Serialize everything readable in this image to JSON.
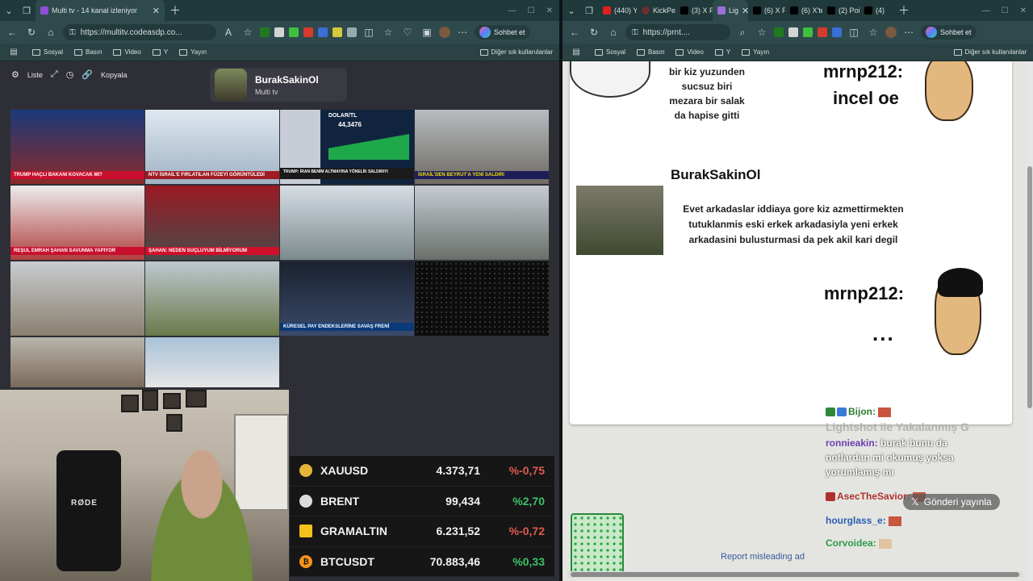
{
  "left_browser": {
    "tabs": [
      {
        "title": "Multi tv - 14 kanal izleniyor",
        "active": true
      }
    ],
    "url": "https://multitv.codeasdp.co...",
    "sohbet_label": "Sohbet et",
    "bookmarks": [
      "Sosyal",
      "Basın",
      "Video",
      "Y",
      "Yayın"
    ],
    "other_bookmarks": "Diğer sık kullanılanlar"
  },
  "multitv": {
    "toolbar": {
      "list_label": "Liste",
      "copy_label": "Kopyala"
    },
    "channel": {
      "name": "BurakSakinOl",
      "subtitle": "Multi tv"
    },
    "captions": [
      "TRUMP HAÇLI BAKANI KOVACAK MI?",
      "NTV İSRAİL'E FIRLATILAN FÜZEYİ GÖRÜNTÜLEDİ",
      "TRUMP: İRAN BENİM ALTMAYINA YÖNELİK SALDIRIYI",
      "İSRAİL'DEN BEYRUT'A YENİ SALDIRI",
      "REŞUL EMRAH ŞAHAN SAVUNMA YAPIYOR",
      "ŞAHAN: NEDEN SUÇLUYUM BİLMİYORUM",
      "KÜRESEL PAY ENDEKSLERİNE SAVAŞ FRENİ"
    ],
    "dolar_label": "DOLAR/TL",
    "dolar_value": "44,3476"
  },
  "webcam": {
    "mic_brand": "RØDE"
  },
  "ticker": [
    {
      "symbol": "XAUUSD",
      "value": "4.373,71",
      "change": "%-0,75",
      "color": "#e05a4f",
      "icon_color": "#e5b53a"
    },
    {
      "symbol": "BRENT",
      "value": "99,434",
      "change": "%2,70",
      "color": "#3cc26a",
      "icon_color": "#dcdcdc"
    },
    {
      "symbol": "GRAMALTIN",
      "value": "6.231,52",
      "change": "%-0,72",
      "color": "#e05a4f",
      "icon_color": "#f2c21b"
    },
    {
      "symbol": "BTCUSDT",
      "value": "70.883,46",
      "change": "%0,33",
      "color": "#3cc26a",
      "icon_color": "#f7931a"
    }
  ],
  "right_browser": {
    "tabs": [
      {
        "title": "(440) Y"
      },
      {
        "title": "KickPe"
      },
      {
        "title": "(3) X P"
      },
      {
        "title": "Lig",
        "active": true
      },
      {
        "title": "(6) X P"
      },
      {
        "title": "(6) X'te"
      },
      {
        "title": "(2) Poi"
      },
      {
        "title": "(4)"
      }
    ],
    "url": "https://prnt....",
    "sohbet_label": "Sohbet et",
    "bookmarks": [
      "Sosyal",
      "Basın",
      "Video",
      "Y",
      "Yayın"
    ],
    "other_bookmarks": "Diğer sık kullanılanlar"
  },
  "meme": {
    "text1": "bir kiz yuzunden sucsuz biri mezara bir salak da hapise gitti",
    "user1": "mrnp212:",
    "incel": "incel oe",
    "burak": "BurakSakinOl",
    "message": "Evet arkadaslar iddiaya gore kiz azmettirmekten tutuklanmis eski erkek arkadasiyla yeni erkek arkadasini bulusturmasi da pek akil kari degil",
    "user2": "mrnp212:",
    "dots": "..."
  },
  "chat": {
    "lightshot": "Lightshot ile Yakalanmış G",
    "lines": [
      {
        "user": "Bijon:",
        "color": "#2e7d32",
        "text": ""
      },
      {
        "user": "ronnieakin:",
        "color": "#6a3fb5",
        "text": "burak bunu da"
      },
      {
        "user": "",
        "color": "#ffffff",
        "text": "notlardan mi okumuş yoksa"
      },
      {
        "user": "",
        "color": "#ffffff",
        "text": "yorumlamış mı"
      },
      {
        "user": "AsecTheSavior:",
        "color": "#b03030",
        "text": ""
      },
      {
        "user": "hourglass_e:",
        "color": "#2a5fb0",
        "text": ""
      },
      {
        "user": "Corvoidea:",
        "color": "#2e9a4a",
        "text": ""
      }
    ],
    "gonderi_label": "Gönderi yayınla",
    "report_label": "Report misleading ad"
  }
}
